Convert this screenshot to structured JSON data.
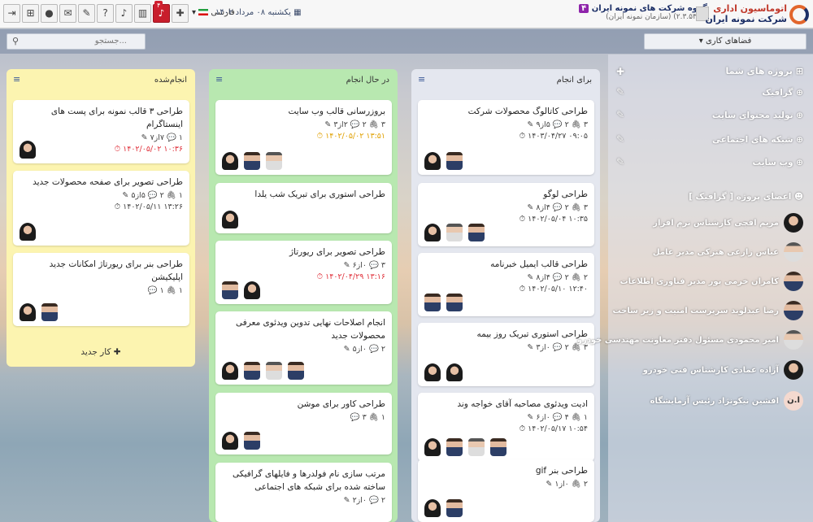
{
  "header": {
    "brand_line1": "اتوماسیون اداری",
    "brand_line2": "شرکت نمونه ایران",
    "org_title": "گروه شرکت های نمونه ایران",
    "org_badge": "۴",
    "org_sub": "(۲.۳.۵۳۰۱) (سازمان نمونه ایران)",
    "date": "یکشنبه ۰۸ مرداد ۱۴۰۲",
    "language": "فارسی",
    "notification_count": "۴"
  },
  "toolbar": {
    "search_placeholder": "جستجو...",
    "workspaces_label": "فضاهای کاری"
  },
  "columns": [
    {
      "title": "برای انجام",
      "cards": [
        {
          "title": "طراحی کاتالوگ محصولات شرکت",
          "meta1": "۳ 🖇  ۲ 💬  ۵از۹ ✎",
          "meta2": "۰۹:۰۵ ۱۴۰۳/۰۴/۲۷ ⏱"
        },
        {
          "title": "طراحی لوگو",
          "meta1": "۳ 🖇  ۲ 💬  ۴از۸ ✎",
          "meta2": "۱۰:۳۵ ۱۴۰۲/۰۵/۰۴ ⏱"
        },
        {
          "title": "طراحی قالب ایمیل خبرنامه",
          "meta1": "۲ 🖇  ۲ 💬  ۴از۸ ✎",
          "meta2": "۱۲:۴۰ ۱۴۰۲/۰۵/۱۰ ⏱"
        },
        {
          "title": "طراحی استوری تبریک روز بیمه",
          "meta1": "۳ 🖇  ۲ 💬  ۰از۳ ✎",
          "meta2": ""
        },
        {
          "title": "ادیت ویدئوی مصاحبه آقای خواجه وند",
          "meta1": "۱ 🖇  ۴ 💬  ۰از۶ ✎",
          "meta2": "۱۰:۵۴ ۱۴۰۲/۰۵/۱۷ ⏱"
        },
        {
          "title": "طراحی بنر gif",
          "meta1": "۲ 🖇  ۰از۱ ✎",
          "meta2": ""
        }
      ]
    },
    {
      "title": "در حال انجام",
      "cards": [
        {
          "title": "بروزرسانی قالب وب سایت",
          "meta1": "۳ 🖇  ۲ 💬  ۲از۳ ✎",
          "meta2": "۱۳:۵۱ ۱۴۰۲/۰۵/۰۲ ⏱"
        },
        {
          "title": "طراحی استوری برای تبریک شب یلدا",
          "meta1": "",
          "meta2": ""
        },
        {
          "title": "طراحی تصویر برای ریورتاژ",
          "meta1": "۳ 💬  ۰از۶ ✎",
          "meta2": "۱۳:۱۶ ۱۴۰۲/۰۴/۲۹ ⏱"
        },
        {
          "title": "انجام اصلاحات نهایی تدوین ویدئوی معرفی محصولات جدید",
          "meta1": "۲ 💬  ۰از۵ ✎",
          "meta2": ""
        },
        {
          "title": "طراحی کاور برای موشن",
          "meta1": "۱ 🖇  ۳ 💬",
          "meta2": ""
        },
        {
          "title": "مرتب سازی نام فولدرها و فایلهای گرافیکی ساخته شده برای شبکه های اجتماعی",
          "meta1": "۲ 💬  ۰از۲ ✎",
          "meta2": ""
        }
      ]
    },
    {
      "title": "انجام‌شده",
      "cards": [
        {
          "title": "طراحی ۳ قالب نمونه برای پست های اینستاگرام",
          "meta1": "۱ 💬  ۷از۷ ✎",
          "meta2": "۱۰:۳۶ ۱۴۰۲/۰۵/۰۲ ⏱"
        },
        {
          "title": "طراحی تصویر برای صفحه محصولات جدید",
          "meta1": "۱ 🖇  ۲ 💬  ۵از۵ ✎",
          "meta2": "۱۳:۲۶ ۱۴۰۲/۰۵/۱۱ ⏱"
        },
        {
          "title": "طراحی بنر برای ریورتاژ امکانات جدید اپلیکیشن",
          "meta1": "۱ 🖇  ۱ 💬",
          "meta2": ""
        }
      ],
      "add_task": "کار جدید"
    }
  ],
  "sidebar": {
    "projects_title": "پروژه های شما",
    "projects": [
      "گرافیک",
      "تولید محتوای سایت",
      "شبکه های اجتماعی",
      "وب سایت"
    ],
    "members_title": "اعضای پروژه [ گرافیک ]",
    "members": [
      "مریم افچی کارشناس نرم افزار",
      "عباس زارعی هنزکی مدیر عامل",
      "کامران خرمی پور مدیر فناوری اطلاعات",
      "رضا عبدلوند سرپرست امنیت و زیر ساخت",
      "امیر محمودی مسئول دفتر معاونت مهندسی خودرو",
      "آزاده عمادی کارشناس فنی خودرو",
      "افشین نیکونژاد رئیس آزمایشگاه"
    ],
    "member_initials": "ا.ن"
  },
  "colors": {
    "col_todo": "#e4e7ef",
    "col_doing": "#b8e8b0",
    "col_done": "#fcf4b0",
    "accent": "#c81e2c"
  }
}
